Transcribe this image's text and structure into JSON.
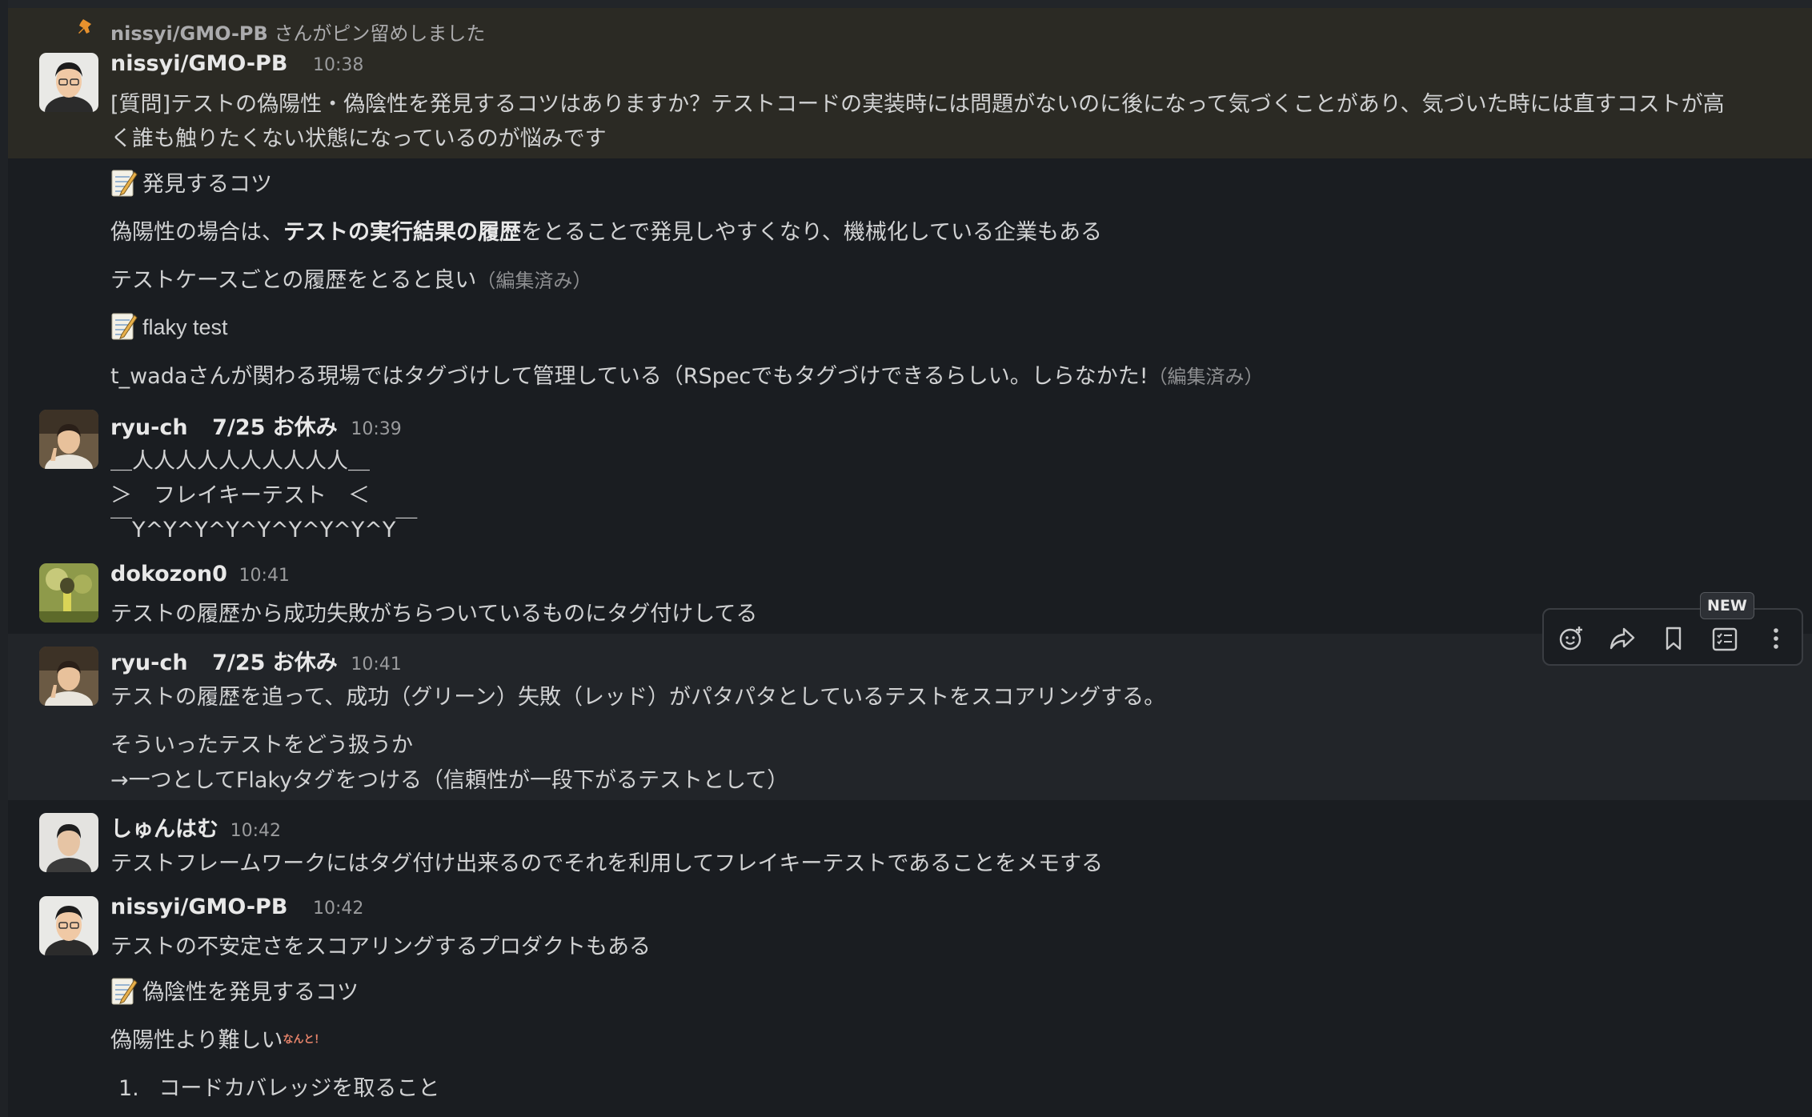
{
  "pin_notice": {
    "user": "nissyi/GMO-PB",
    "text": "さんがピン留めしました"
  },
  "messages": [
    {
      "user": "nissyi/GMO-PB",
      "time": "10:38",
      "line1": "[質問]テストの偽陽性・偽陰性を発見するコツはありますか？テストコードの実装時には問題がないのに後になって気づくことがあり、気づいた時には直すコストが高",
      "line2": "く誰も触りたくない状態になっているのが悩みです"
    }
  ],
  "thread1": {
    "heading1": "発見するコツ",
    "p1_pre": "偽陽性の場合は、",
    "p1_bold": "テストの実行結果の履歴",
    "p1_post": "をとることで発見しやすくなり、機械化している企業もある",
    "p2": "テストケースごとの履歴をとると良い",
    "p2_edited": "（編集済み）",
    "heading2": "flaky test",
    "p3": "t_wadaさんが関わる現場ではタグづけして管理している（RSpecでもタグづけできるらしい。しらなかた!",
    "p3_edited": "（編集済み）"
  },
  "ryu1": {
    "user": "ryu-ch",
    "status": "7/25 お休み",
    "time": "10:39",
    "aa1": "＿人人人人人人人人人人＿",
    "aa2": "＞　フレイキーテスト　＜",
    "aa3": "￣Y^Y^Y^Y^Y^Y^Y^Y^Y￣"
  },
  "dokozon": {
    "user": "dokozon0",
    "time": "10:41",
    "text": "テストの履歴から成功失敗がちらついているものにタグ付けしてる"
  },
  "ryu2": {
    "user": "ryu-ch",
    "status": "7/25 お休み",
    "time": "10:41",
    "p1": "テストの履歴を追って、成功（グリーン）失敗（レッド）がパタパタとしているテストをスコアリングする。",
    "p2": "そういったテストをどう扱うか",
    "p3": "→一つとしてFlakyタグをつける（信頼性が一段下がるテストとして）"
  },
  "shunhamu": {
    "user": "しゅんはむ",
    "time": "10:42",
    "text": "テストフレームワークにはタグ付け出来るのでそれを利用してフレイキーテストであることをメモする"
  },
  "nissyi2": {
    "user": "nissyi/GMO-PB",
    "time": "10:42",
    "p1": "テストの不安定さをスコアリングするプロダクトもある",
    "heading": "偽陰性を発見するコツ",
    "p2": "偽陽性より難しい",
    "p2_small": "なんと！",
    "li_num": "1.",
    "li1": "コードカバレッジを取ること"
  },
  "toolbar": {
    "new_badge": "NEW",
    "icons": [
      "add-reaction-icon",
      "forward-icon",
      "bookmark-icon",
      "later-list-icon",
      "more-actions-icon"
    ]
  },
  "colors": {
    "background": "#1a1d21",
    "pinned_bg": "#2b2a24",
    "hover_bg": "#222529",
    "pin_accent": "#e8912d"
  }
}
